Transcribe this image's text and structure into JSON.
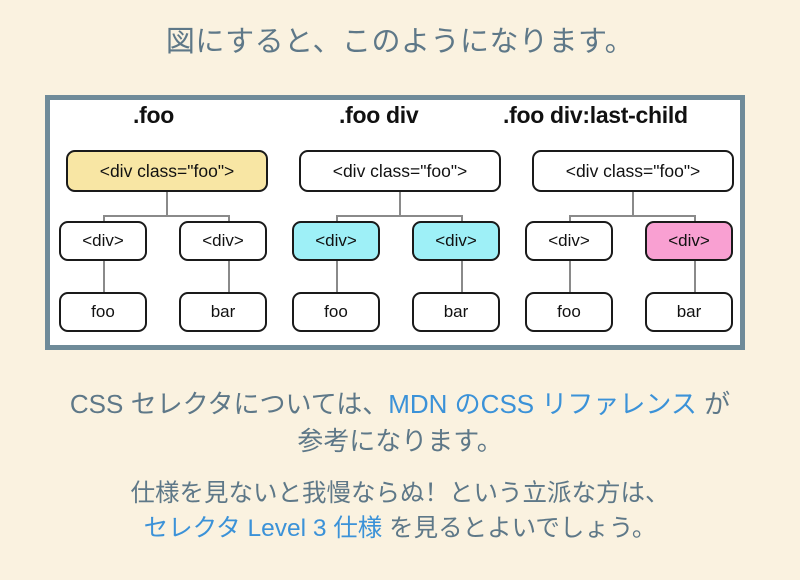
{
  "slide": {
    "title": "図にすると、このようになります。",
    "background_color": "#faf2e0",
    "text_color": "#5e7888",
    "link_color": "#3b92d8"
  },
  "diagram": {
    "frame_border_color": "#6f8b99",
    "frame_background": "#ffffff",
    "connector_color": "#8a8a8a",
    "columns": [
      {
        "header": ".foo",
        "highlight_color": "#f8e6a4",
        "root": {
          "label": "<div class=\"foo\">",
          "highlight": "yellow"
        },
        "children": [
          {
            "label": "<div>",
            "highlight": "none"
          },
          {
            "label": "<div>",
            "highlight": "none"
          }
        ],
        "leaves": [
          {
            "label": "foo"
          },
          {
            "label": "bar"
          }
        ]
      },
      {
        "header": ".foo div",
        "highlight_color": "#9ef0f7",
        "root": {
          "label": "<div class=\"foo\">",
          "highlight": "none"
        },
        "children": [
          {
            "label": "<div>",
            "highlight": "cyan"
          },
          {
            "label": "<div>",
            "highlight": "cyan"
          }
        ],
        "leaves": [
          {
            "label": "foo"
          },
          {
            "label": "bar"
          }
        ]
      },
      {
        "header": ".foo div:last-child",
        "highlight_color": "#f9a0d2",
        "root": {
          "label": "<div class=\"foo\">",
          "highlight": "none"
        },
        "children": [
          {
            "label": "<div>",
            "highlight": "none"
          },
          {
            "label": "<div>",
            "highlight": "pink"
          }
        ],
        "leaves": [
          {
            "label": "foo"
          },
          {
            "label": "bar"
          }
        ]
      }
    ]
  },
  "paragraph_1": {
    "before": "CSS セレクタについては、",
    "link": "MDN のCSS リファレンス",
    "after": " が",
    "line2": "参考になります。"
  },
  "paragraph_2": {
    "line1": "仕様を見ないと我慢ならぬ！という立派な方は、",
    "link": "セレクタ Level 3 仕様",
    "after": " を見るとよいでしょう。"
  }
}
